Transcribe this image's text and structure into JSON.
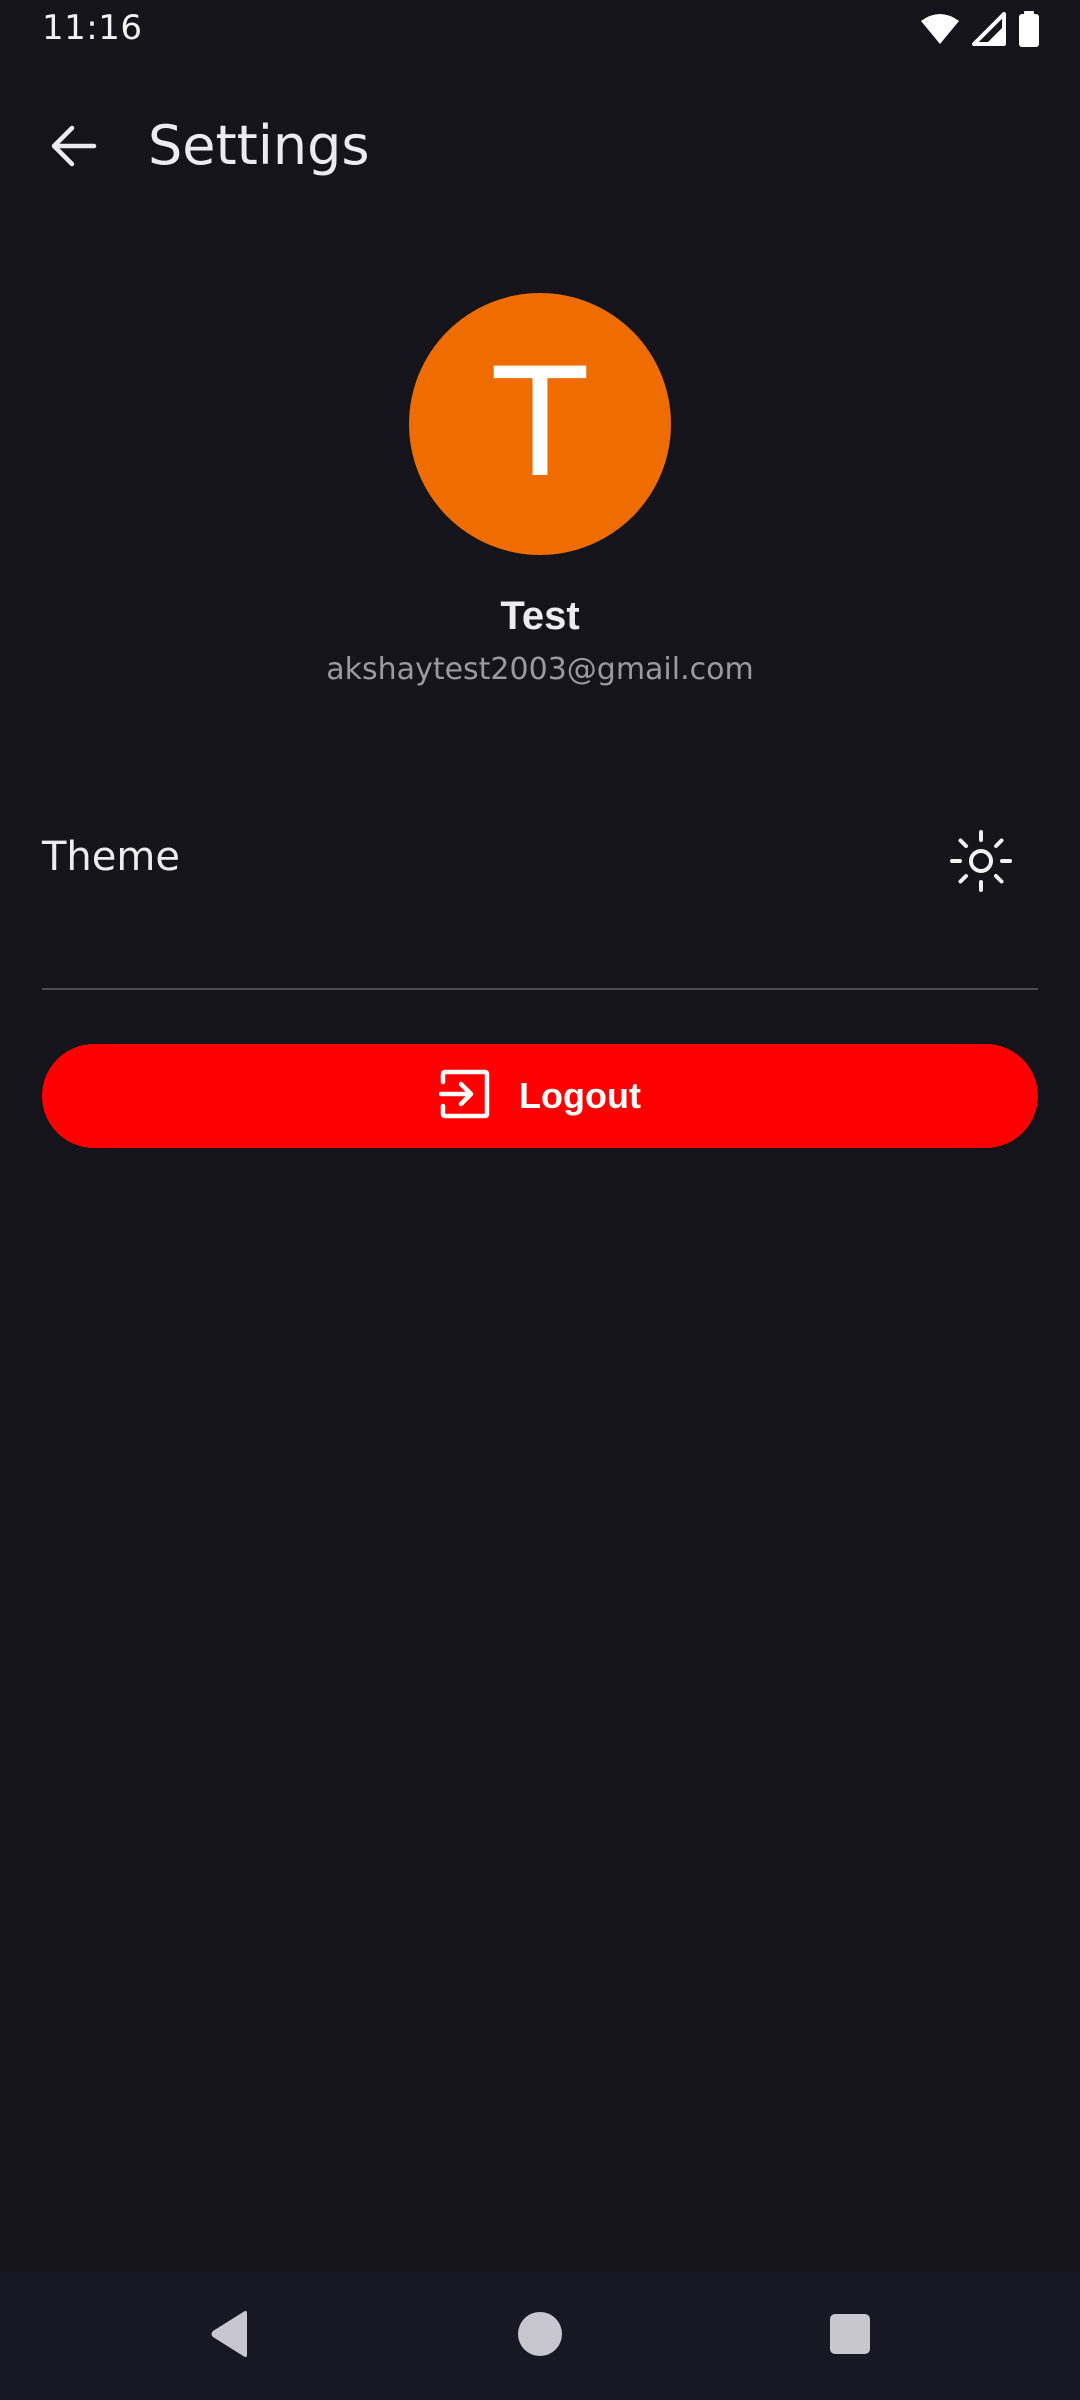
{
  "status_bar": {
    "time": "11:16",
    "icons": [
      "wifi-icon",
      "cell-signal-icon",
      "battery-icon"
    ]
  },
  "app_bar": {
    "back_icon": "arrow-back-icon",
    "title": "Settings"
  },
  "profile": {
    "avatar_initial": "T",
    "avatar_color": "#ef6c00",
    "name": "Test",
    "email": "akshaytest2003@gmail.com"
  },
  "settings": {
    "theme_label": "Theme",
    "theme_icon": "sun-icon"
  },
  "logout": {
    "label": "Logout",
    "icon": "logout-icon",
    "color": "#ff0000"
  },
  "nav_bar": {
    "buttons": [
      "back-triangle-icon",
      "home-circle-icon",
      "recents-square-icon"
    ]
  },
  "colors": {
    "background": "#14141a",
    "nav_background": "#181824",
    "text_primary": "#ececf0",
    "text_secondary": "#9a99a2"
  }
}
